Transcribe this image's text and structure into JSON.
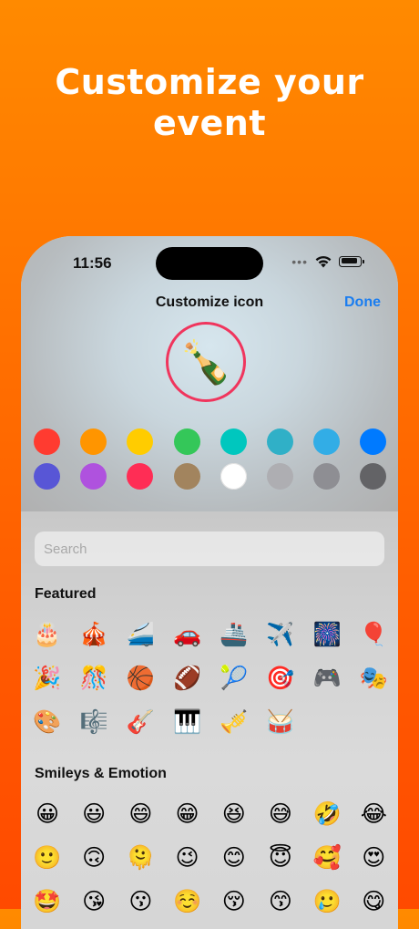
{
  "headline": [
    "Customize your",
    "event"
  ],
  "status": {
    "time": "11:56",
    "dots": "•••"
  },
  "nav": {
    "title": "Customize icon",
    "done_label": "Done"
  },
  "selected_icon": {
    "emoji": "🍾",
    "ring_color": "#f0355d"
  },
  "colors": {
    "row1": [
      "#ff3b30",
      "#ff9500",
      "#ffcc00",
      "#34c759",
      "#00c7be",
      "#30b0c7",
      "#32ade6",
      "#007aff"
    ],
    "row2": [
      "#5856d6",
      "#af52de",
      "#ff2d55",
      "#a2845e",
      "#ffffff",
      "#aeaeb2",
      "#8e8e93",
      "#636366"
    ]
  },
  "search": {
    "placeholder": "Search"
  },
  "featured": {
    "title": "Featured",
    "emojis": [
      "🎂",
      "🎪",
      "🚄",
      "🚗",
      "🚢",
      "✈️",
      "🎆",
      "🎈",
      "🎉",
      "🎊",
      "🏀",
      "🏈",
      "🎾",
      "🎯",
      "🎮",
      "🎭",
      "🎨",
      "🎼",
      "🎸",
      "🎹",
      "🎺",
      "🥁"
    ]
  },
  "smileys": {
    "title": "Smileys & Emotion",
    "emojis": [
      "😀",
      "😃",
      "😄",
      "😁",
      "😆",
      "😅",
      "🤣",
      "😂",
      "🙂",
      "🙃",
      "🫠",
      "😉",
      "😊",
      "😇",
      "🥰",
      "😍",
      "🤩",
      "😘",
      "😗",
      "☺️",
      "😚",
      "😙",
      "🥲",
      "😋"
    ]
  }
}
